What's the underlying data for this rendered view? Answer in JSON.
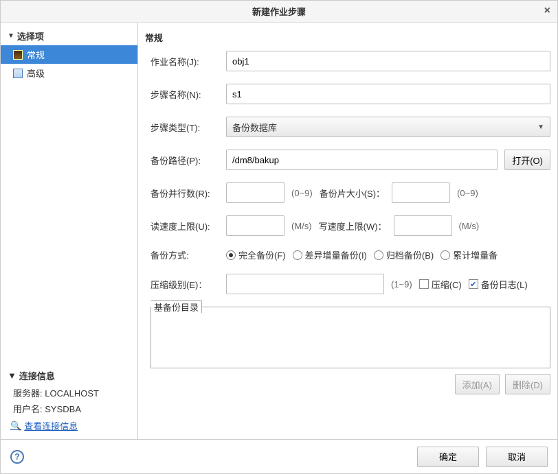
{
  "title": "新建作业步骤",
  "sidebar": {
    "options_header": "选择项",
    "items": [
      {
        "label": "常规",
        "selected": true
      },
      {
        "label": "高级",
        "selected": false
      }
    ],
    "conn_header": "连接信息",
    "server_label": "服务器:",
    "server_value": "LOCALHOST",
    "user_label": "用户名:",
    "user_value": "SYSDBA",
    "conn_link": "查看连接信息"
  },
  "main": {
    "section_title": "常规",
    "job_name_label": "作业名称(J):",
    "job_name_value": "obj1",
    "step_name_label": "步骤名称(N):",
    "step_name_value": "s1",
    "step_type_label": "步骤类型(T):",
    "step_type_value": "备份数据库",
    "backup_path_label": "备份路径(P):",
    "backup_path_value": "/dm8/bakup",
    "open_btn": "打开(O)",
    "parallel_label": "备份并行数(R):",
    "parallel_hint": "(0~9)",
    "piece_size_label": "备份片大小(S)：",
    "piece_size_hint": "(0~9)",
    "read_speed_label": "读速度上限(U):",
    "read_speed_hint": "(M/s)",
    "write_speed_label": "写速度上限(W)：",
    "write_speed_hint": "(M/s)",
    "backup_mode_label": "备份方式:",
    "mode_full": "完全备份(F)",
    "mode_diff": "差异增量备份(I)",
    "mode_arch": "归档备份(B)",
    "mode_cumu": "累计增量备",
    "compress_level_label": "压缩级别(E)：",
    "compress_level_hint": "(1~9)",
    "compress_check": "压缩(C)",
    "backup_log_check": "备份日志(L)",
    "base_backup_dir": "基备份目录",
    "add_btn": "添加(A)",
    "delete_btn": "删除(D)"
  },
  "footer": {
    "ok_btn": "确定",
    "cancel_btn": "取消"
  }
}
